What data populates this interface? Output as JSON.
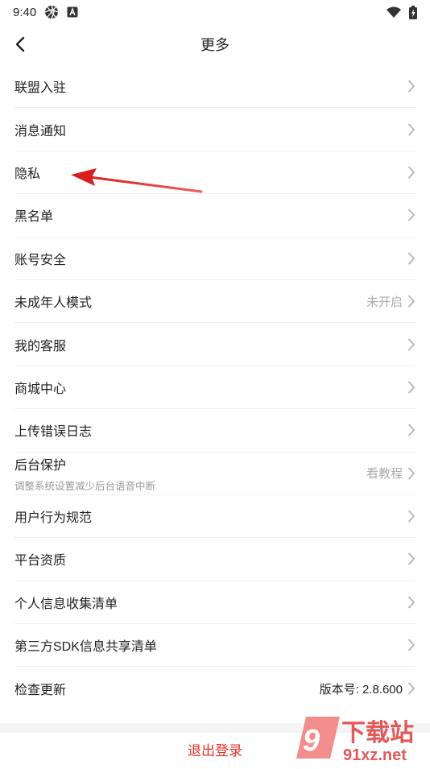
{
  "status_bar": {
    "time": "9:40"
  },
  "header": {
    "title": "更多"
  },
  "menu": [
    {
      "label": "联盟入驻",
      "sub": "",
      "value": ""
    },
    {
      "label": "消息通知",
      "sub": "",
      "value": ""
    },
    {
      "label": "隐私",
      "sub": "",
      "value": ""
    },
    {
      "label": "黑名单",
      "sub": "",
      "value": ""
    },
    {
      "label": "账号安全",
      "sub": "",
      "value": ""
    },
    {
      "label": "未成年人模式",
      "sub": "",
      "value": "未开启"
    },
    {
      "label": "我的客服",
      "sub": "",
      "value": ""
    },
    {
      "label": "商城中心",
      "sub": "",
      "value": ""
    },
    {
      "label": "上传错误日志",
      "sub": "",
      "value": ""
    },
    {
      "label": "后台保护",
      "sub": "调整系统设置减少后台语音中断",
      "value": "看教程"
    },
    {
      "label": "用户行为规范",
      "sub": "",
      "value": ""
    },
    {
      "label": "平台资质",
      "sub": "",
      "value": ""
    },
    {
      "label": "个人信息收集清单",
      "sub": "",
      "value": ""
    },
    {
      "label": "第三方SDK信息共享清单",
      "sub": "",
      "value": ""
    },
    {
      "label": "检查更新",
      "sub": "",
      "value": "版本号: 2.8.600"
    }
  ],
  "logout": {
    "label": "退出登录"
  },
  "watermark": {
    "brand": "下载站",
    "site": "91xz.net"
  },
  "colors": {
    "accent": "#e8312a",
    "muted": "#aaaaaa",
    "divider": "#eeeeee"
  }
}
